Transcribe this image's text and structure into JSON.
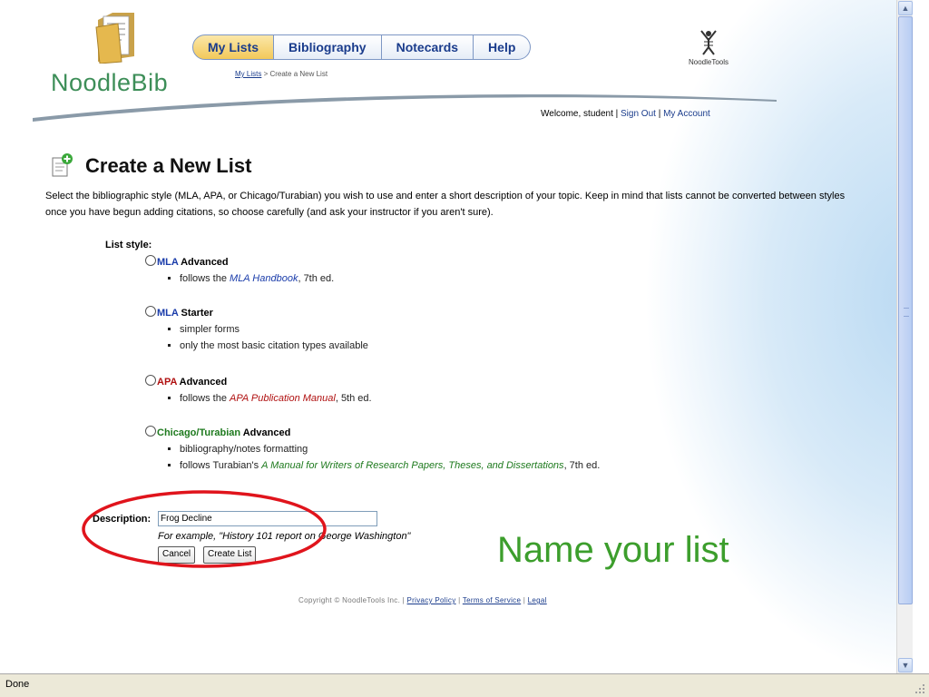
{
  "header": {
    "logo_text": "NoodleBib",
    "nav_tabs": [
      "My Lists",
      "Bibliography",
      "Notecards",
      "Help"
    ],
    "breadcrumb_link": "My Lists",
    "breadcrumb_rest": " > Create a New List",
    "partner_logo": "NoodleTools",
    "welcome_text": "Welcome, student | ",
    "sign_out": "Sign Out",
    "separator": " | ",
    "my_account": "My Account"
  },
  "page": {
    "title": "Create a New List",
    "intro": "Select the bibliographic style (MLA, APA, or Chicago/Turabian) you wish to use and enter a short description of your topic. Keep in mind that lists cannot be converted between styles once you have begun adding citations, so choose carefully (and ask your instructor if you aren't sure).",
    "list_style_label": "List style:"
  },
  "styles": [
    {
      "prefix": "MLA",
      "suffix": " Advanced",
      "bullets": [
        [
          "follows the ",
          "MLA Handbook",
          ", 7th ed."
        ]
      ]
    },
    {
      "prefix": "MLA",
      "suffix": " Starter",
      "bullets": [
        [
          "simpler forms"
        ],
        [
          "only the most basic citation types available"
        ]
      ]
    },
    {
      "prefix": "APA",
      "suffix": " Advanced",
      "bullets": [
        [
          "follows the ",
          "APA Publication Manual",
          ", 5th ed."
        ]
      ]
    },
    {
      "prefix": "Chicago/Turabian",
      "suffix": " Advanced",
      "bullets": [
        [
          "bibliography/notes formatting"
        ],
        [
          "follows Turabian's ",
          "A Manual for Writers of Research Papers, Theses, and Dissertations",
          ", 7th ed."
        ]
      ]
    }
  ],
  "form": {
    "description_label": "Description:",
    "description_value": "Frog Decline",
    "example": "For example, \"History 101 report on George Washington\"",
    "cancel": "Cancel",
    "create": "Create List"
  },
  "annotation": "Name your list",
  "footer": {
    "copyright": "Copyright © NoodleTools Inc. | ",
    "privacy": "Privacy Policy",
    "terms": "Terms of Service",
    "legal": "Legal",
    "sep": " | "
  },
  "status_bar": "Done",
  "colors": {
    "accent_green": "#3c9e2c",
    "annotation_red": "#e0141c",
    "link_blue": "#1a3c8c"
  }
}
